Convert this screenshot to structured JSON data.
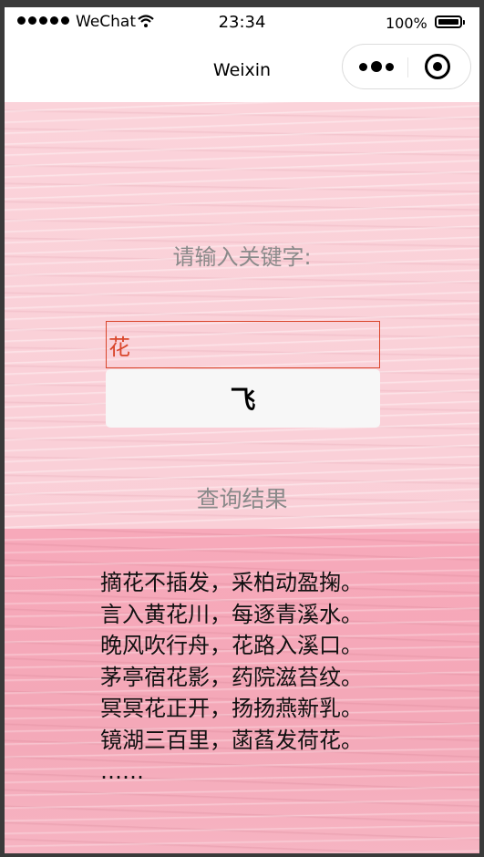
{
  "status_bar": {
    "carrier": "WeChat",
    "time": "23:34",
    "battery_percent": "100%"
  },
  "nav_bar": {
    "title": "Weixin"
  },
  "search": {
    "prompt": "请输入关键字:",
    "value": "花",
    "button_label": "飞"
  },
  "results": {
    "title": "查询结果",
    "lines": [
      "摘花不插发，采柏动盈掬。",
      "言入黄花川，每逐青溪水。",
      "晚风吹行舟，花路入溪口。",
      "茅亭宿花影，药院滋苔纹。",
      "冥冥花正开，扬扬燕新乳。",
      "镜湖三百里，菡萏发荷花。",
      "……"
    ]
  },
  "colors": {
    "accent_red": "#d9462b",
    "background_pink": "#fbd3da",
    "lower_pink": "#f4a8b8"
  }
}
